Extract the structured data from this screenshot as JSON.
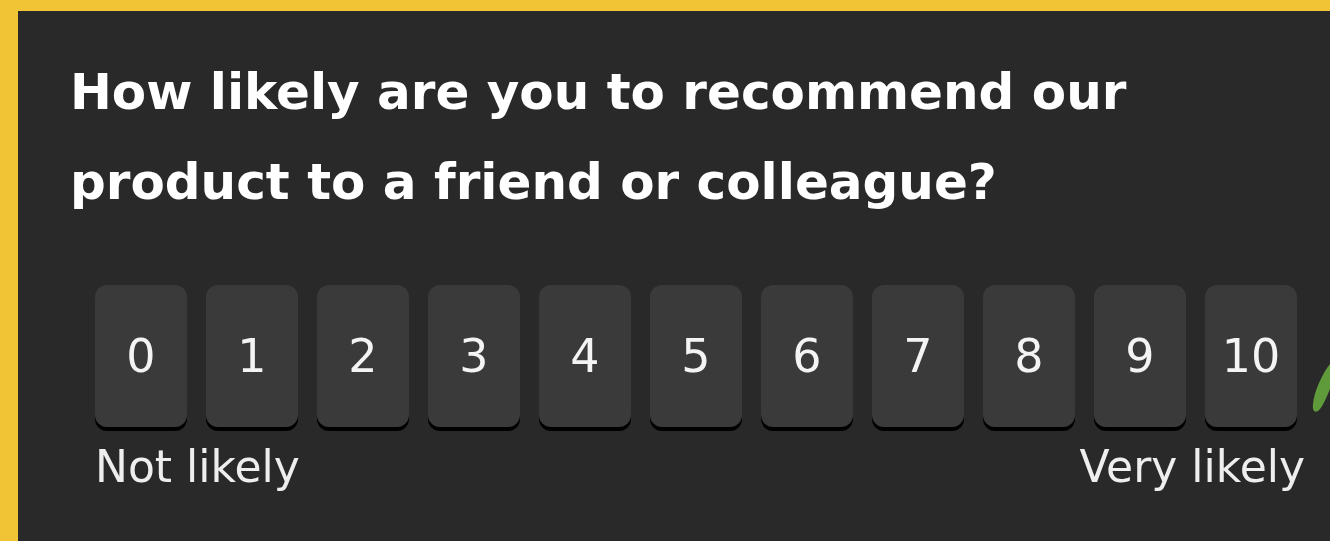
{
  "question": "How likely are you to recommend our product to a friend or colleague?",
  "scale": [
    {
      "label": "0",
      "selected": false
    },
    {
      "label": "1",
      "selected": false
    },
    {
      "label": "2",
      "selected": false
    },
    {
      "label": "3",
      "selected": false
    },
    {
      "label": "4",
      "selected": false
    },
    {
      "label": "5",
      "selected": false
    },
    {
      "label": "6",
      "selected": false
    },
    {
      "label": "7",
      "selected": false
    },
    {
      "label": "8",
      "selected": false
    },
    {
      "label": "9",
      "selected": false
    },
    {
      "label": "10",
      "selected": false
    }
  ],
  "low_label": "Not likely",
  "high_label": "Very likely"
}
